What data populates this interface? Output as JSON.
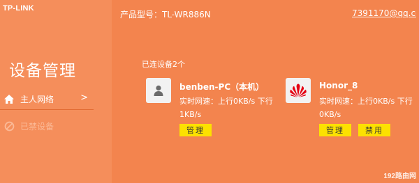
{
  "brand": {
    "logo": "TP-LINK"
  },
  "header": {
    "model_label": "产品型号：TL-WR886N",
    "account": "7391170@qq.co"
  },
  "sidebar": {
    "title": "设备管理",
    "items": [
      {
        "label": "主人网络",
        "icon": "home-icon",
        "chevron": ">"
      },
      {
        "label": "已禁设备",
        "icon": "blocked-icon"
      }
    ]
  },
  "main": {
    "connected_label": "已连设备2个",
    "devices": [
      {
        "name": "benben-PC（本机）",
        "speed": "实时网速：上行0KB/s 下行1KB/s",
        "icon": "pc-user-icon",
        "buttons": [
          "管理"
        ]
      },
      {
        "name": "Honor_8",
        "speed": "实时网速：上行0KB/s 下行0KB/s",
        "icon": "huawei-logo-icon",
        "buttons": [
          "管理",
          "禁用"
        ]
      }
    ]
  },
  "watermark": {
    "text": "192路由网"
  },
  "colors": {
    "background": "#f3844e",
    "sidebar": "#f58e5b",
    "button": "#fce100",
    "huawei": "#e60012"
  }
}
